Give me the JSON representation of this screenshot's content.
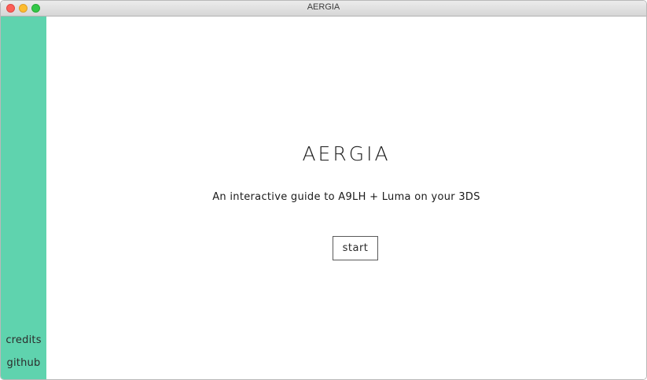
{
  "window": {
    "title": "AERGIA"
  },
  "sidebar": {
    "links": [
      {
        "label": "credits"
      },
      {
        "label": "github"
      }
    ]
  },
  "main": {
    "title": "AERGIA",
    "subtitle": "An interactive guide to A9LH + Luma on your 3DS",
    "start_label": "start"
  },
  "colors": {
    "sidebar": "#5fd3ae",
    "background": "#ffffff",
    "text": "#1a1a1a"
  }
}
